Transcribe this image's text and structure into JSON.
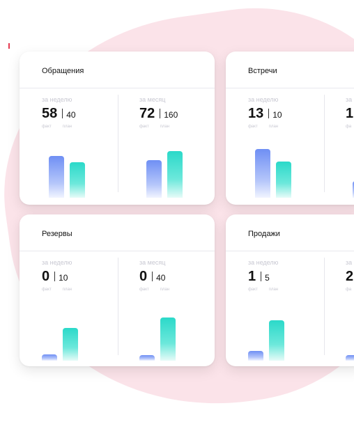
{
  "cards": [
    {
      "title": "Обращения",
      "metrics": [
        {
          "period": "за неделю",
          "fact": 58,
          "plan": 40,
          "fact_label": "факт",
          "plan_label": "план",
          "fact_bar": 0.62,
          "plan_bar": 0.53
        },
        {
          "period": "за месяц",
          "fact": 72,
          "plan": 160,
          "fact_label": "факт",
          "plan_label": "план",
          "fact_bar": 0.56,
          "plan_bar": 0.7
        }
      ]
    },
    {
      "title": "Встречи",
      "metrics": [
        {
          "period": "за неделю",
          "fact": 13,
          "plan": 10,
          "fact_label": "факт",
          "plan_label": "план",
          "fact_bar": 0.73,
          "plan_bar": 0.54
        },
        {
          "period": "за",
          "fact": 1,
          "plan": "",
          "fact_label": "фа",
          "plan_label": "",
          "fact_bar": 0.25,
          "plan_bar": 0
        }
      ]
    },
    {
      "title": "Резервы",
      "metrics": [
        {
          "period": "за неделю",
          "fact": 0,
          "plan": 10,
          "fact_label": "факт",
          "plan_label": "план",
          "fact_bar": 0.09,
          "plan_bar": 0.49
        },
        {
          "period": "за месяц",
          "fact": 0,
          "plan": 40,
          "fact_label": "факт",
          "plan_label": "план",
          "fact_bar": 0.08,
          "plan_bar": 0.65
        }
      ]
    },
    {
      "title": "Продажи",
      "metrics": [
        {
          "period": "за неделю",
          "fact": 1,
          "plan": 5,
          "fact_label": "факт",
          "plan_label": "план",
          "fact_bar": 0.15,
          "plan_bar": 0.6
        },
        {
          "period": "за",
          "fact": 2,
          "plan": "",
          "fact_label": "фа",
          "plan_label": "",
          "fact_bar": 0.08,
          "plan_bar": 0
        }
      ]
    }
  ],
  "colors": {
    "background_blob": "#fbe3e9",
    "fact_bar": "#6f8ff4",
    "plan_bar": "#2bd9c9",
    "accent_mark": "#e53950"
  }
}
